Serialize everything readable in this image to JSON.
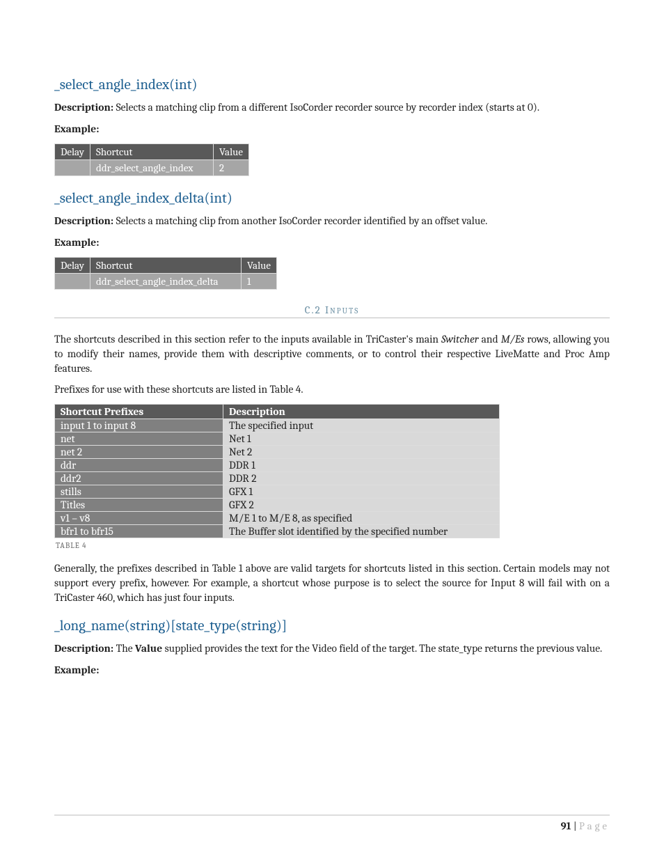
{
  "sec1": {
    "title": "_select_angle_index(int)",
    "desc_label": "Description:",
    "desc_text": " Selects a matching clip from a different IsoCorder recorder source by recorder index (starts at 0).",
    "example_label": "Example:",
    "table": {
      "h1": "Delay",
      "h2": "Shortcut",
      "h3": "Value",
      "r1c1": "",
      "r1c2": "ddr_select_angle_index",
      "r1c3": "2"
    }
  },
  "sec2": {
    "title": "_select_angle_index_delta(int)",
    "desc_label": "Description:",
    "desc_text": " Selects a matching clip from another IsoCorder recorder identified by an offset value.",
    "example_label": "Example:",
    "table": {
      "h1": "Delay",
      "h2": "Shortcut",
      "h3": "Value",
      "r1c1": "",
      "r1c2": "ddr_select_angle_index_delta",
      "r1c3": "1"
    }
  },
  "inputs_section": {
    "num": "C.2",
    "label": " Inputs",
    "para1a": "The shortcuts described in this section refer to the inputs available in TriCaster's main ",
    "para1b": "Switcher",
    "para1c": " and ",
    "para1d": "M/Es",
    "para1e": " rows, allowing you to modify their names, provide them with descriptive comments, or to control their respective LiveMatte and Proc Amp features.",
    "para2": "Prefixes for use with these shortcuts are listed in Table 4.",
    "prefix_table": {
      "h1": "Shortcut Prefixes",
      "h2": "Description",
      "rows": [
        {
          "k": "input 1 to input 8",
          "v": "The specified input"
        },
        {
          "k": "net",
          "v": "Net 1"
        },
        {
          "k": "net 2",
          "v": "Net 2"
        },
        {
          "k": "ddr",
          "v": "DDR 1"
        },
        {
          "k": "ddr2",
          "v": "DDR 2"
        },
        {
          "k": "stills",
          "v": "GFX 1"
        },
        {
          "k": "Titles",
          "v": "GFX 2"
        },
        {
          "k": "v1 – v8",
          "v": "M/E 1 to M/E 8, as specified"
        },
        {
          "k": "bfr1 to bfr15",
          "v": "The Buffer slot identified by the specified number"
        }
      ]
    },
    "table_caption": "TABLE 4",
    "para3": "Generally, the prefixes described in Table 1 above are valid targets for shortcuts listed in this section. Certain models may not support every prefix, however. For example, a shortcut whose purpose is to select the source for  Input 8 will fail with on a TriCaster 460, which has just four inputs."
  },
  "sec3": {
    "title": "_long_name(string)[state_type(string)]",
    "desc_label": "Description:",
    "desc_text1": " The ",
    "desc_bold": "Value",
    "desc_text2": " supplied provides the text for the Video field of the target. The state_type returns the previous value.",
    "example_label": "Example:"
  },
  "footer": {
    "num": "91",
    "sep": " | ",
    "text": "Page"
  }
}
